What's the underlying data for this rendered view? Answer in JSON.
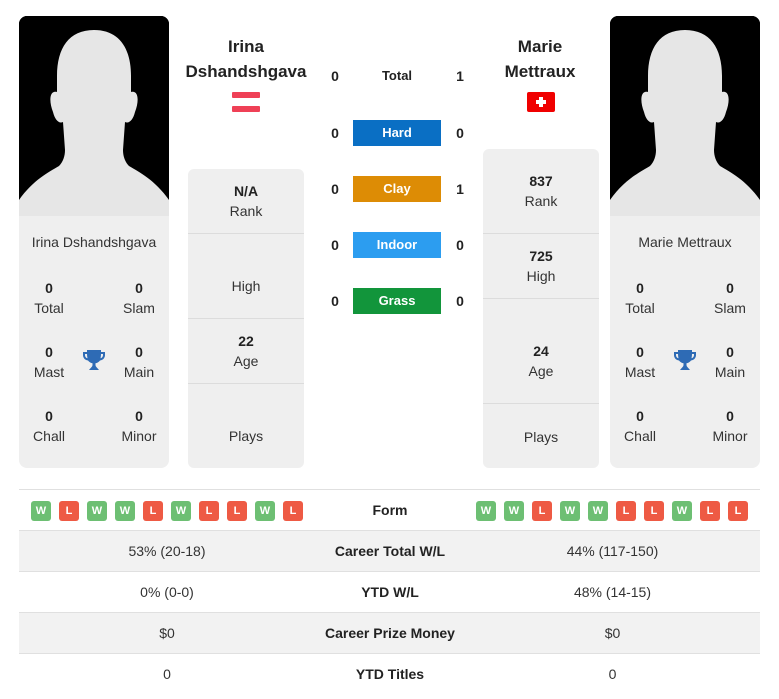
{
  "colors": {
    "hard": "#0a6fc4",
    "clay": "#dd8c05",
    "indoor": "#2c9df0",
    "grass": "#12953b",
    "win": "#6dbf73",
    "loss": "#ee5a44",
    "trophy": "#2e6bb5"
  },
  "player1": {
    "name": "Irina Dshandshgava",
    "name_line1": "Irina",
    "name_line2": "Dshandshgava",
    "flag_icon": "austria-flag-icon",
    "card_name": "Irina Dshandshgava",
    "titles": {
      "total": {
        "value": "0",
        "label": "Total"
      },
      "slam": {
        "value": "0",
        "label": "Slam"
      },
      "mast": {
        "value": "0",
        "label": "Mast"
      },
      "main": {
        "value": "0",
        "label": "Main"
      },
      "chall": {
        "value": "0",
        "label": "Chall"
      },
      "minor": {
        "value": "0",
        "label": "Minor"
      }
    },
    "rank": {
      "value": "N/A",
      "label": "Rank"
    },
    "high": {
      "value": "",
      "label": "High"
    },
    "age": {
      "value": "22",
      "label": "Age"
    },
    "plays": {
      "value": "",
      "label": "Plays"
    },
    "form": [
      "W",
      "L",
      "W",
      "W",
      "L",
      "W",
      "L",
      "L",
      "W",
      "L"
    ]
  },
  "player2": {
    "name": "Marie Mettraux",
    "name_line1": "Marie",
    "name_line2": "Mettraux",
    "flag_icon": "switzerland-flag-icon",
    "card_name": "Marie Mettraux",
    "titles": {
      "total": {
        "value": "0",
        "label": "Total"
      },
      "slam": {
        "value": "0",
        "label": "Slam"
      },
      "mast": {
        "value": "0",
        "label": "Mast"
      },
      "main": {
        "value": "0",
        "label": "Main"
      },
      "chall": {
        "value": "0",
        "label": "Chall"
      },
      "minor": {
        "value": "0",
        "label": "Minor"
      }
    },
    "rank": {
      "value": "837",
      "label": "Rank"
    },
    "high": {
      "value": "725",
      "label": "High"
    },
    "age": {
      "value": "24",
      "label": "Age"
    },
    "plays": {
      "value": "",
      "label": "Plays"
    },
    "form": [
      "W",
      "W",
      "L",
      "W",
      "W",
      "L",
      "L",
      "W",
      "L",
      "L"
    ]
  },
  "h2h": [
    {
      "label": "Total",
      "p1": "0",
      "p2": "1",
      "key": "total"
    },
    {
      "label": "Hard",
      "p1": "0",
      "p2": "0",
      "key": "hard"
    },
    {
      "label": "Clay",
      "p1": "0",
      "p2": "1",
      "key": "clay"
    },
    {
      "label": "Indoor",
      "p1": "0",
      "p2": "0",
      "key": "indoor"
    },
    {
      "label": "Grass",
      "p1": "0",
      "p2": "0",
      "key": "grass"
    }
  ],
  "comparison": {
    "form_label": "Form",
    "rows": [
      {
        "label": "Career Total W/L",
        "p1": "53% (20-18)",
        "p2": "44% (117-150)"
      },
      {
        "label": "YTD W/L",
        "p1": "0% (0-0)",
        "p2": "48% (14-15)"
      },
      {
        "label": "Career Prize Money",
        "p1": "$0",
        "p2": "$0"
      },
      {
        "label": "YTD Titles",
        "p1": "0",
        "p2": "0"
      }
    ]
  }
}
